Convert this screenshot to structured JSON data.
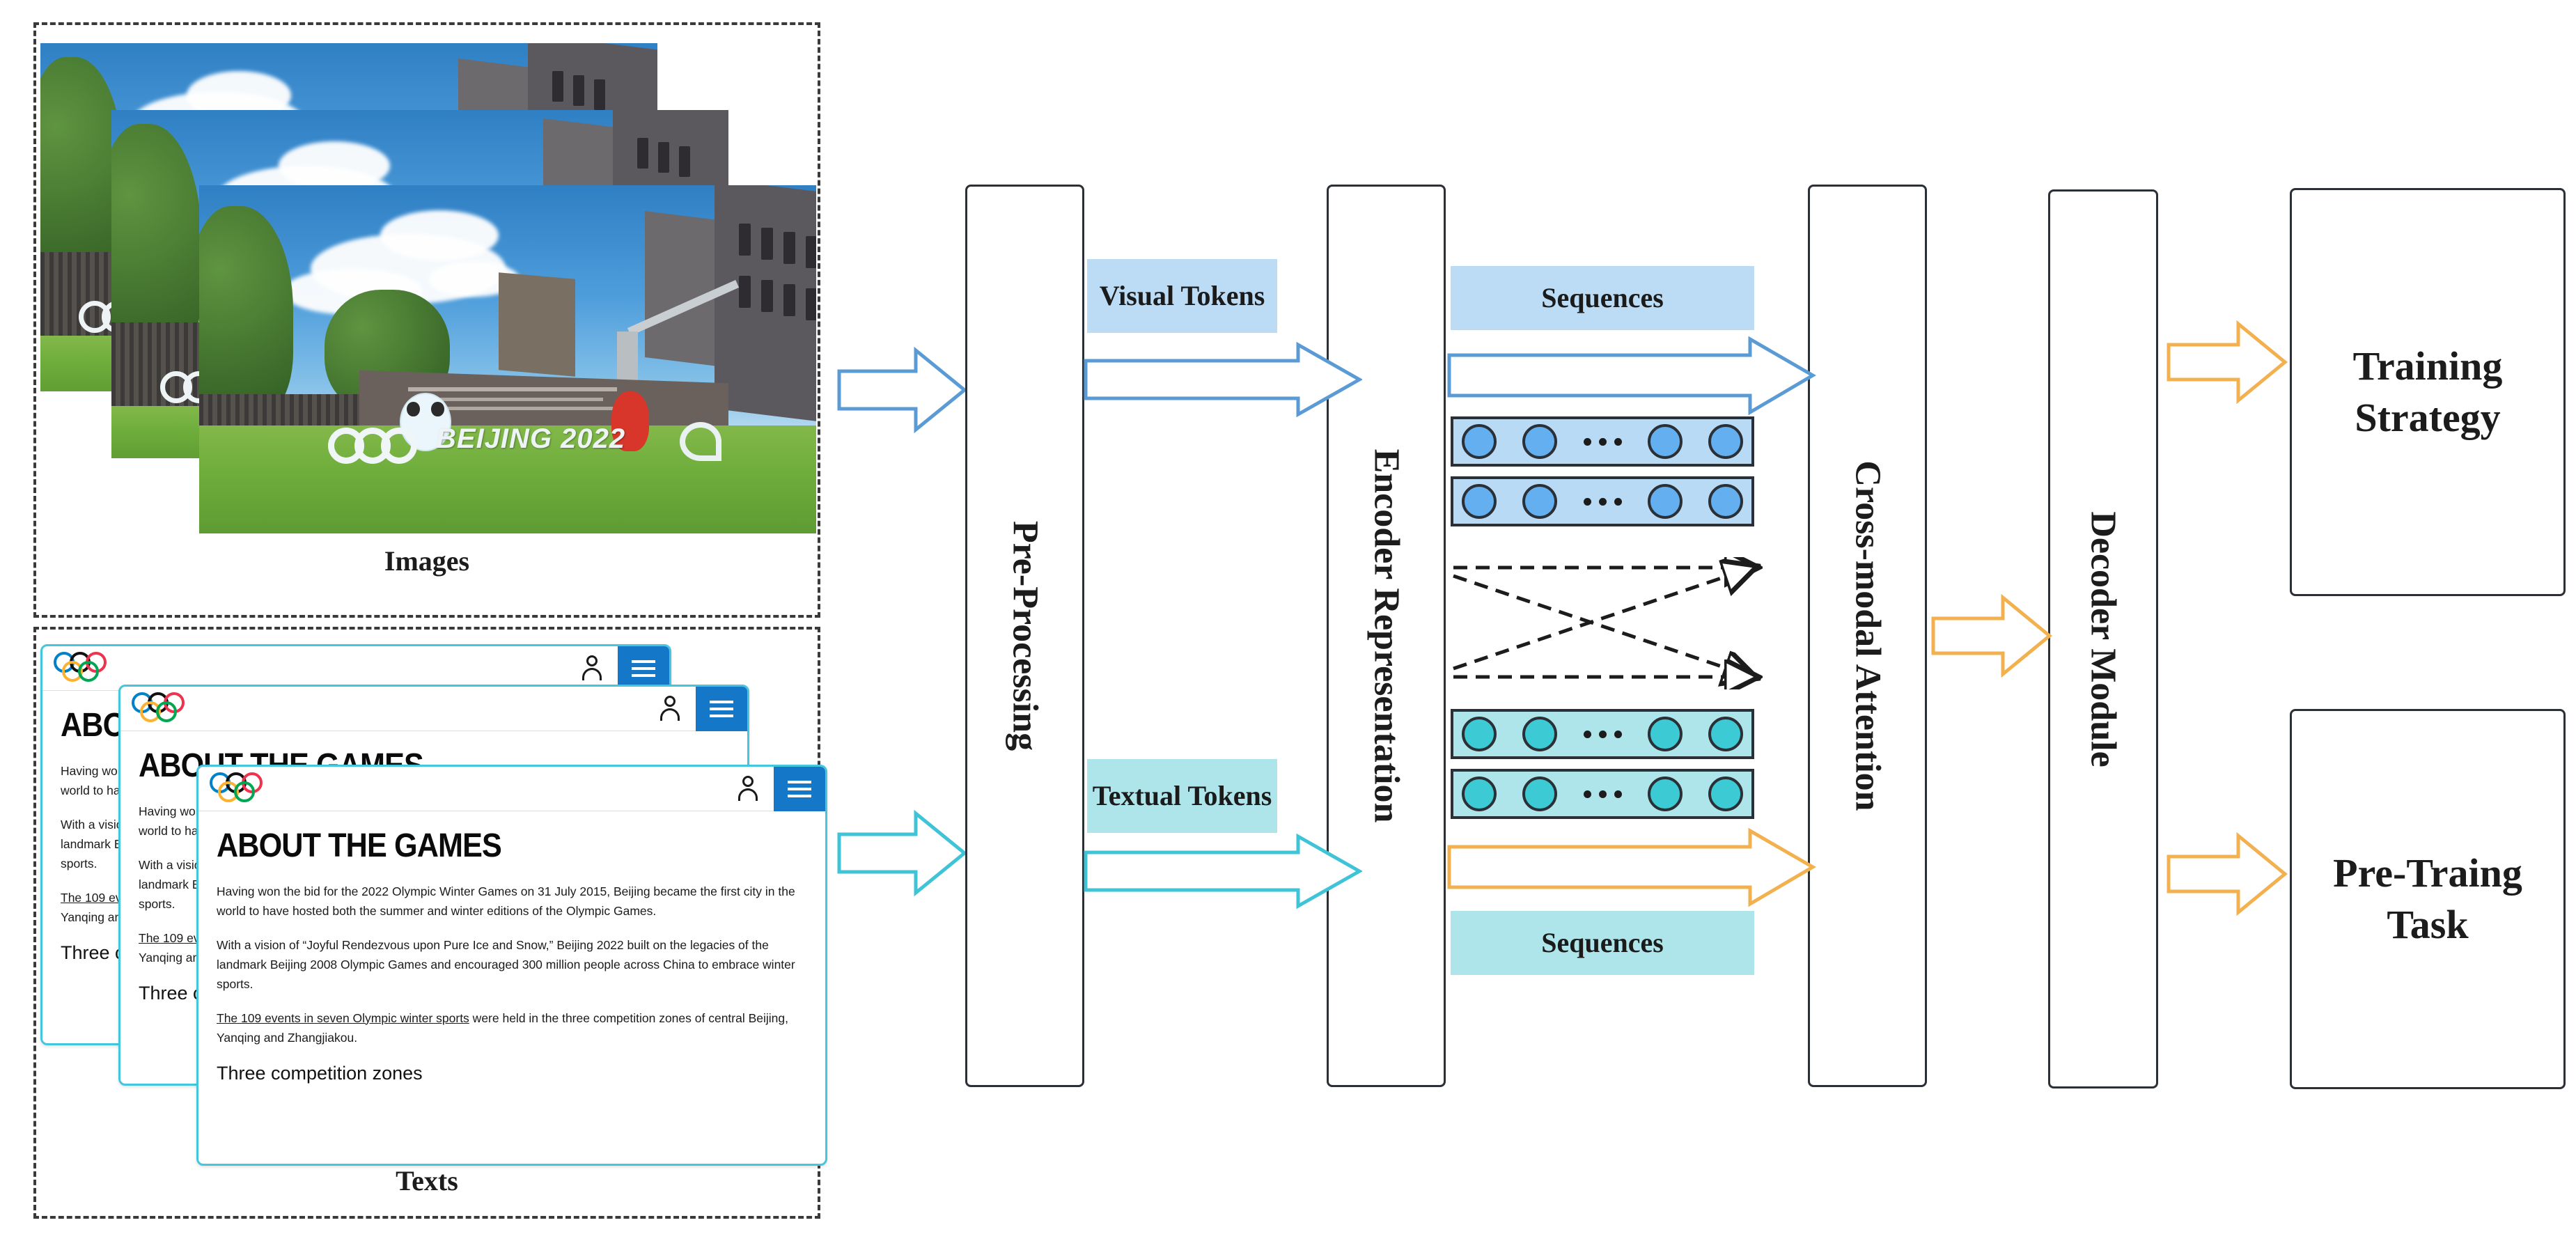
{
  "inputs": {
    "images_caption": "Images",
    "texts_caption": "Texts",
    "image_alt": "Beijing 2022 Olympic Winter Games venue photo",
    "browser": {
      "logo_icon": "olympic-rings-icon",
      "account_icon": "person-icon",
      "menu_icon": "hamburger-menu-icon",
      "title": "ABOUT THE GAMES",
      "paragraphs": [
        "Having won the bid for the 2022 Olympic Winter Games on 31 July 2015, Beijing became the first city in the world to have hosted both the summer and winter editions of the Olympic Games.",
        "With a vision of “Joyful Rendezvous upon Pure Ice and Snow,” Beijing 2022 built on the legacies of the landmark Beijing 2008 Olympic Games and encouraged 300 million people across China to embrace winter sports."
      ],
      "link_text": "The 109 events in seven Olympic winter sports",
      "link_rest": " were held in the three competition zones of central Beijing, Yanqing and Zhangjiakou.",
      "subheading": "Three competition zones"
    }
  },
  "pipeline": {
    "pre_processing": "Pre-Processing",
    "encoder_representation": "Encoder Representation",
    "cross_modal_attention": "Cross-modal Attention",
    "decoder_module": "Decoder Module",
    "training_strategy": "Training Strategy",
    "pretrain_task": "Pre-Traing Task"
  },
  "tokens": {
    "visual": "Visual Tokens",
    "textual": "Textual Tokens",
    "sequences_top": "Sequences",
    "sequences_bottom": "Sequences"
  },
  "colors": {
    "visual_blue_fill": "#bcdcf5",
    "visual_blue_node": "#63aff0",
    "visual_blue_bg": "#b8daf5",
    "textual_cyan_fill": "#aee5ea",
    "textual_cyan_node": "#3ccbd4",
    "textual_cyan_bg": "#ade5ea",
    "arrow_blue": "#5b9bd5",
    "arrow_cyan": "#3fc3d6",
    "arrow_orange": "#f2b04e",
    "box_border": "#2b2f36",
    "browser_border": "#45c6dd",
    "menu_blue": "#1477c8"
  },
  "sequence_rows": {
    "visual_rows": 2,
    "textual_rows": 2,
    "nodes_per_row": 4,
    "ellipsis_dots": 3
  },
  "cross_arrows": {
    "count": 4,
    "style": "dashed"
  }
}
